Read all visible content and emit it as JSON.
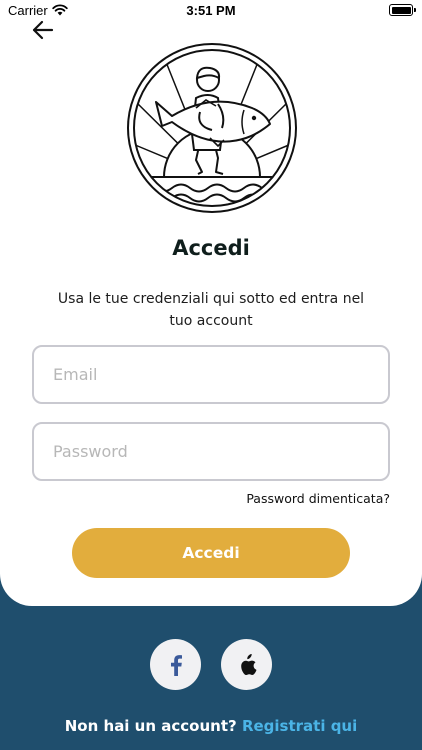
{
  "status_bar": {
    "carrier": "Carrier",
    "time": "3:51 PM"
  },
  "header": {
    "back_icon": "arrow-left-icon"
  },
  "logo": {
    "icon": "fisherman-with-tuna-logo"
  },
  "login": {
    "title": "Accedi",
    "subtitle": "Usa le tue credenziali qui sotto ed entra nel tuo account",
    "email_placeholder": "Email",
    "password_placeholder": "Password",
    "forgot_password": "Password dimenticata?",
    "submit_label": "Accedi"
  },
  "social": {
    "facebook_icon": "facebook-icon",
    "apple_icon": "apple-icon"
  },
  "footer": {
    "prompt": "Non hai un account?",
    "register_link": "Registrati qui"
  },
  "colors": {
    "primary_button": "#e2ad3d",
    "bottom_background": "#1f4e6d",
    "link": "#4bb4e6"
  }
}
